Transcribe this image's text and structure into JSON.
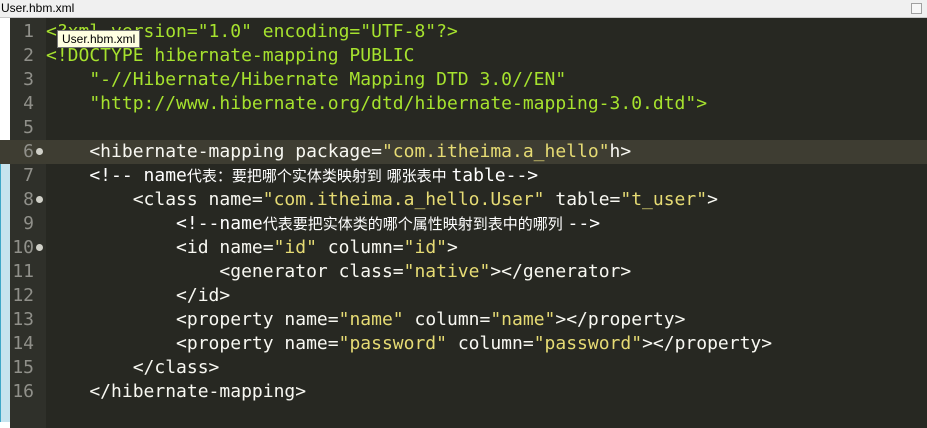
{
  "tab": {
    "filename": "User.hbm.xml"
  },
  "tooltip": {
    "text": "User.hbm.xml"
  },
  "colors": {
    "editor_bg": "#272822",
    "current_line_bg": "#3e3d32",
    "string": "#e6db74",
    "green": "#a6e22e",
    "text": "#f8f8f2",
    "gutter_number": "#90908a"
  },
  "lines": [
    {
      "n": "1",
      "segments": [
        {
          "c": "g",
          "t": "<?xml version=\"1.0\" encoding=\"UTF-8\"?>"
        }
      ]
    },
    {
      "n": "2",
      "segments": [
        {
          "c": "g",
          "t": "<!DOCTYPE hibernate-mapping PUBLIC"
        }
      ]
    },
    {
      "n": "3",
      "segments": [
        {
          "c": "g",
          "t": "    \"-//Hibernate/Hibernate Mapping DTD 3.0//EN\""
        }
      ]
    },
    {
      "n": "4",
      "segments": [
        {
          "c": "g",
          "t": "    \"http://www.hibernate.org/dtd/hibernate-mapping-3.0.dtd\">"
        }
      ]
    },
    {
      "n": "5",
      "segments": []
    },
    {
      "n": "6",
      "current": true,
      "fold": true,
      "segments": [
        {
          "c": "t",
          "t": "    <hibernate-mapping package="
        },
        {
          "c": "s",
          "t": "\"com.itheima.a_hello\""
        },
        {
          "c": "t",
          "t": "h>"
        }
      ]
    },
    {
      "n": "7",
      "segments": [
        {
          "c": "w",
          "t": "    <!-- name"
        },
        {
          "c": "w cjk",
          "t": "代表：要把哪个实体类映射到 哪张表中 "
        },
        {
          "c": "w",
          "t": "table-->"
        }
      ]
    },
    {
      "n": "8",
      "fold": true,
      "segments": [
        {
          "c": "t",
          "t": "        <class name="
        },
        {
          "c": "s",
          "t": "\"com.itheima.a_hello.User\""
        },
        {
          "c": "t",
          "t": " table="
        },
        {
          "c": "s",
          "t": "\"t_user\""
        },
        {
          "c": "t",
          "t": ">"
        }
      ]
    },
    {
      "n": "9",
      "segments": [
        {
          "c": "w",
          "t": "            <!--name"
        },
        {
          "c": "w cjk",
          "t": "代表要把实体类的哪个属性映射到表中的哪列 "
        },
        {
          "c": "w",
          "t": "-->"
        }
      ]
    },
    {
      "n": "10",
      "fold": true,
      "segments": [
        {
          "c": "t",
          "t": "            <id name="
        },
        {
          "c": "s",
          "t": "\"id\""
        },
        {
          "c": "t",
          "t": " column="
        },
        {
          "c": "s",
          "t": "\"id\""
        },
        {
          "c": "t",
          "t": ">"
        }
      ]
    },
    {
      "n": "11",
      "segments": [
        {
          "c": "t",
          "t": "                <generator class="
        },
        {
          "c": "s",
          "t": "\"native\""
        },
        {
          "c": "t",
          "t": "></generator>"
        }
      ]
    },
    {
      "n": "12",
      "segments": [
        {
          "c": "t",
          "t": "            </id>"
        }
      ]
    },
    {
      "n": "13",
      "segments": [
        {
          "c": "t",
          "t": "            <property name="
        },
        {
          "c": "s",
          "t": "\"name\""
        },
        {
          "c": "t",
          "t": " column="
        },
        {
          "c": "s",
          "t": "\"name\""
        },
        {
          "c": "t",
          "t": "></property>"
        }
      ]
    },
    {
      "n": "14",
      "segments": [
        {
          "c": "t",
          "t": "            <property name="
        },
        {
          "c": "s",
          "t": "\"password\""
        },
        {
          "c": "t",
          "t": " column="
        },
        {
          "c": "s",
          "t": "\"password\""
        },
        {
          "c": "t",
          "t": "></property>"
        }
      ]
    },
    {
      "n": "15",
      "segments": [
        {
          "c": "t",
          "t": "        </class>"
        }
      ]
    },
    {
      "n": "16",
      "segments": [
        {
          "c": "t",
          "t": "    </hibernate-mapping>"
        }
      ]
    }
  ]
}
